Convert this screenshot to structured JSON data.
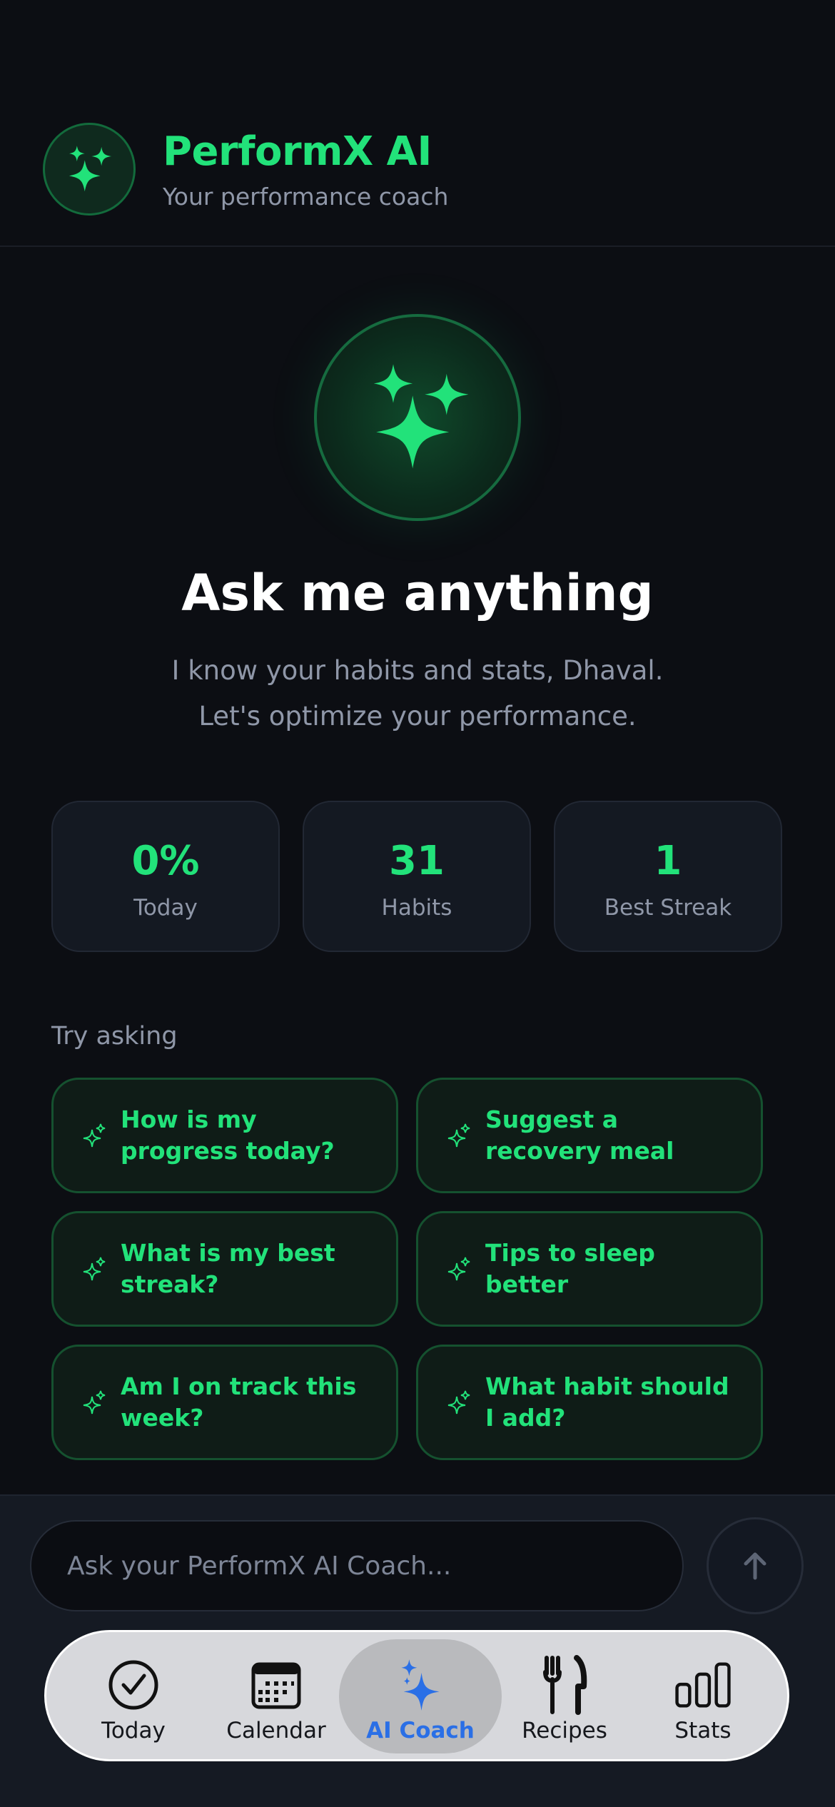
{
  "header": {
    "title": "PerformX AI",
    "subtitle": "Your performance coach",
    "logo_icon": "sparkles-icon"
  },
  "hero": {
    "icon": "sparkles-icon",
    "title": "Ask me anything",
    "line1": "I know your habits and stats, Dhaval.",
    "line2": "Let's optimize your performance."
  },
  "stats": [
    {
      "value": "0%",
      "label": "Today"
    },
    {
      "value": "31",
      "label": "Habits"
    },
    {
      "value": "1",
      "label": "Best Streak"
    }
  ],
  "suggestions": {
    "heading": "Try asking",
    "items": [
      "How is my progress today?",
      "Suggest a recovery meal",
      "What is my best streak?",
      "Tips to sleep better",
      "Am I on track this week?",
      "What habit should I add?"
    ]
  },
  "input": {
    "placeholder": "Ask your PerformX AI Coach...",
    "value": "",
    "send_icon": "arrow-up-icon"
  },
  "tabs": [
    {
      "label": "Today",
      "icon": "check-circle-icon",
      "active": false
    },
    {
      "label": "Calendar",
      "icon": "calendar-icon",
      "active": false
    },
    {
      "label": "AI Coach",
      "icon": "sparkles-icon",
      "active": true
    },
    {
      "label": "Recipes",
      "icon": "fork-knife-icon",
      "active": false
    },
    {
      "label": "Stats",
      "icon": "bar-chart-icon",
      "active": false
    }
  ],
  "colors": {
    "accent": "#22e27a",
    "background": "#0c0e13",
    "active_tab": "#2a6fe6"
  }
}
